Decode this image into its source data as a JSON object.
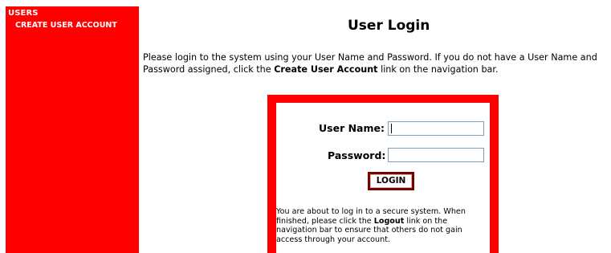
{
  "sidebar": {
    "header": "USERS",
    "items": [
      {
        "label": "CREATE USER ACCOUNT"
      }
    ]
  },
  "main": {
    "title": "User Login",
    "intro": {
      "text_before": "Please login to the system using your User Name and Password. If you do not have a User Name and Password assigned, click the ",
      "link_text": "Create User Account",
      "text_after": " link on the navigation bar."
    }
  },
  "login_form": {
    "username_label": "User Name:",
    "username_value": "",
    "password_label": "Password:",
    "password_value": "",
    "login_button": "LOGIN",
    "notice": {
      "text_before": "You are about to log in to a secure system. When finished, please click the ",
      "link_text": "Logout",
      "text_after": " link on the navigation bar to ensure that others do not gain access through your account."
    }
  },
  "colors": {
    "accent": "#ff0000",
    "button_border": "#7a0000",
    "sidebar_text": "#ffffff"
  }
}
